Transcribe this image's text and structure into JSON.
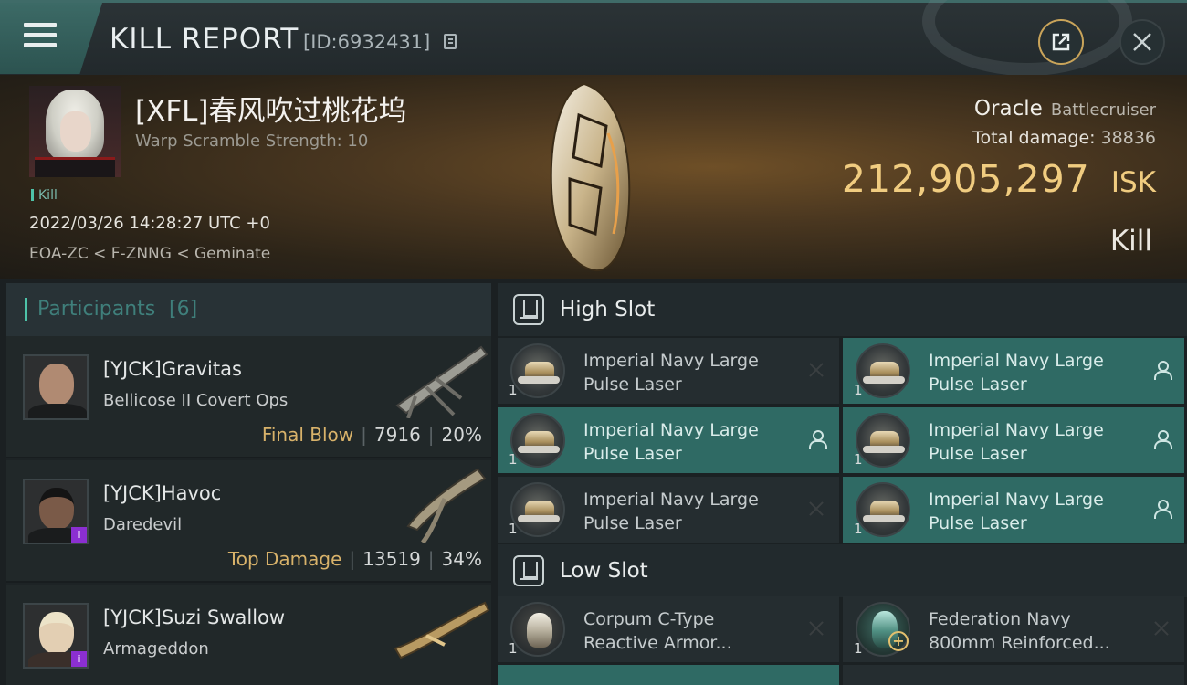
{
  "header": {
    "title": "KILL REPORT",
    "report_id": "[ID:6932431]"
  },
  "victim": {
    "name": "[XFL]春风吹过桃花坞",
    "warp_scramble": "Warp Scramble Strength: 10",
    "tag": "Kill",
    "datetime": "2022/03/26 14:28:27 UTC +0",
    "location": "EOA-ZC < F-ZNNG < Geminate",
    "ship_name": "Oracle",
    "ship_class": "Battlecruiser",
    "total_damage_label": "Total damage:",
    "total_damage": "38836",
    "isk_value": "212,905,297",
    "isk_unit": "ISK",
    "result": "Kill"
  },
  "participants": {
    "title": "Participants",
    "count": "[6]",
    "items": [
      {
        "name": "[YJCK]Gravitas",
        "ship": "Bellicose II Covert Ops",
        "tag": "Final Blow",
        "damage": "7916",
        "percent": "20%",
        "badge": ""
      },
      {
        "name": "[YJCK]Havoc",
        "ship": "Daredevil",
        "tag": "Top Damage",
        "damage": "13519",
        "percent": "34%",
        "badge": "i"
      },
      {
        "name": "[YJCK]Suzi Swallow",
        "ship": "Armageddon",
        "tag": "",
        "damage": "",
        "percent": "",
        "badge": "i"
      }
    ]
  },
  "slots": {
    "high": {
      "title": "High Slot",
      "modules": [
        {
          "line1": "Imperial Navy Large",
          "line2": "Pulse Laser",
          "qty": "1",
          "state": "destroyed",
          "state_icon": "x-icon"
        },
        {
          "line1": "Imperial Navy Large",
          "line2": "Pulse Laser",
          "qty": "1",
          "state": "dropped",
          "state_icon": "person-icon"
        },
        {
          "line1": "Imperial Navy Large",
          "line2": "Pulse Laser",
          "qty": "1",
          "state": "dropped",
          "state_icon": "person-icon"
        },
        {
          "line1": "Imperial Navy Large",
          "line2": "Pulse Laser",
          "qty": "1",
          "state": "dropped",
          "state_icon": "person-icon"
        },
        {
          "line1": "Imperial Navy Large",
          "line2": "Pulse Laser",
          "qty": "1",
          "state": "destroyed",
          "state_icon": "x-icon"
        },
        {
          "line1": "Imperial Navy Large",
          "line2": "Pulse Laser",
          "qty": "1",
          "state": "dropped",
          "state_icon": "person-icon"
        }
      ]
    },
    "low": {
      "title": "Low Slot",
      "modules": [
        {
          "line1": "Corpum C-Type",
          "line2": "Reactive Armor...",
          "qty": "1",
          "state": "destroyed",
          "state_icon": "x-icon"
        },
        {
          "line1": "Federation Navy",
          "line2": "800mm Reinforced...",
          "qty": "1",
          "state": "destroyed",
          "state_icon": "x-icon"
        }
      ]
    }
  },
  "colors": {
    "accent_teal": "#4ec3a9",
    "isk_gold": "#f0cc80",
    "active_module": "#2f6a64",
    "implant_badge": "#8b2fd1"
  }
}
